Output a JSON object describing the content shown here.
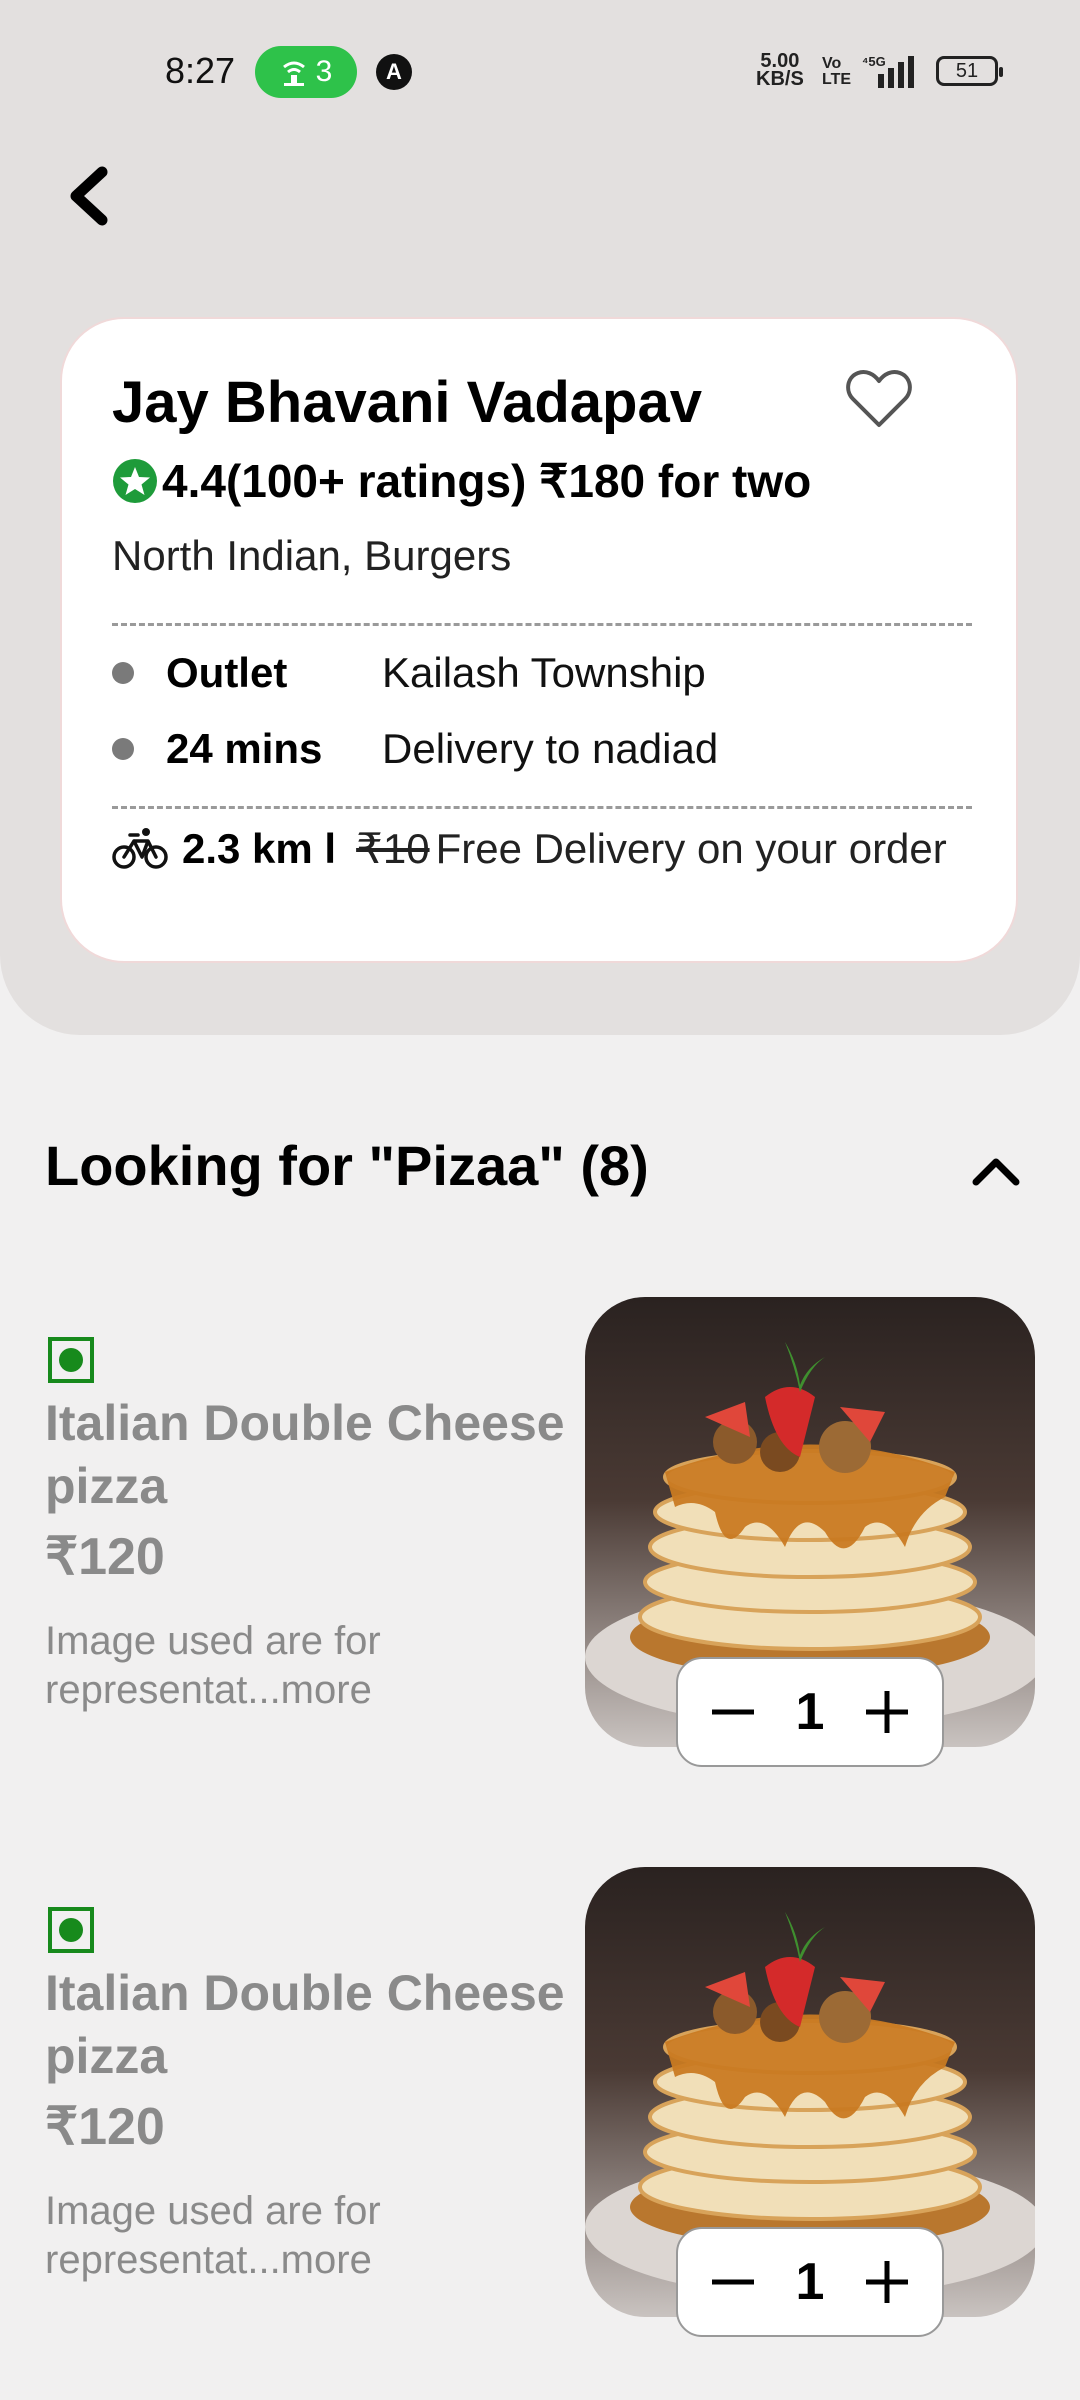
{
  "status_bar": {
    "time": "8:27",
    "hotspot_count": "3",
    "speed_value": "5.00",
    "speed_unit": "KB/S",
    "volte": "Vo\nLTE",
    "network": "5G",
    "battery": "51"
  },
  "restaurant": {
    "name": "Jay Bhavani Vadapav",
    "rating": "4.4(100+ ratings) ₹180 for two",
    "cuisine": "North Indian, Burgers",
    "outlet_label": "Outlet",
    "outlet_value": "Kailash Township",
    "time_label": "24 mins",
    "time_value": "Delivery to nadiad",
    "distance": "2.3 km l",
    "old_fee": "₹10",
    "free_delivery": "Free Delivery on your order"
  },
  "section": {
    "title": "Looking for \"Pizaa\" (8)"
  },
  "items": [
    {
      "name": "Italian Double Cheese pizza",
      "price": "₹120",
      "description": "Image used are for representat...more",
      "quantity": "1"
    },
    {
      "name": "Italian Double Cheese pizza",
      "price": "₹120",
      "description": "Image used are for representat...more",
      "quantity": "1"
    }
  ],
  "colors": {
    "veg_green": "#178a1c",
    "star_green": "#1e9b3a",
    "header_bg": "#e3e0df",
    "page_bg": "#f1f0f0"
  }
}
